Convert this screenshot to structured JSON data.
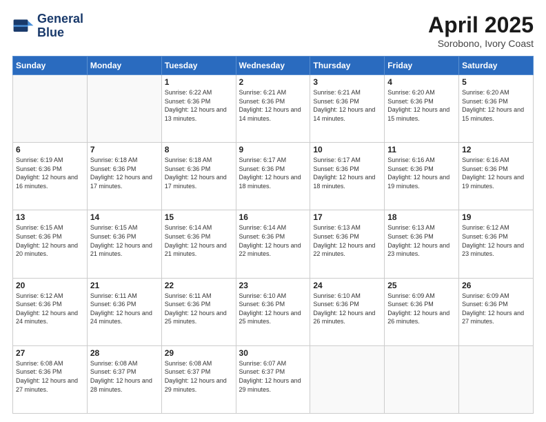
{
  "header": {
    "logo_line1": "General",
    "logo_line2": "Blue",
    "month": "April 2025",
    "location": "Sorobono, Ivory Coast"
  },
  "days_of_week": [
    "Sunday",
    "Monday",
    "Tuesday",
    "Wednesday",
    "Thursday",
    "Friday",
    "Saturday"
  ],
  "weeks": [
    [
      {
        "day": "",
        "sunrise": "",
        "sunset": "",
        "daylight": ""
      },
      {
        "day": "",
        "sunrise": "",
        "sunset": "",
        "daylight": ""
      },
      {
        "day": "1",
        "sunrise": "Sunrise: 6:22 AM",
        "sunset": "Sunset: 6:36 PM",
        "daylight": "Daylight: 12 hours and 13 minutes."
      },
      {
        "day": "2",
        "sunrise": "Sunrise: 6:21 AM",
        "sunset": "Sunset: 6:36 PM",
        "daylight": "Daylight: 12 hours and 14 minutes."
      },
      {
        "day": "3",
        "sunrise": "Sunrise: 6:21 AM",
        "sunset": "Sunset: 6:36 PM",
        "daylight": "Daylight: 12 hours and 14 minutes."
      },
      {
        "day": "4",
        "sunrise": "Sunrise: 6:20 AM",
        "sunset": "Sunset: 6:36 PM",
        "daylight": "Daylight: 12 hours and 15 minutes."
      },
      {
        "day": "5",
        "sunrise": "Sunrise: 6:20 AM",
        "sunset": "Sunset: 6:36 PM",
        "daylight": "Daylight: 12 hours and 15 minutes."
      }
    ],
    [
      {
        "day": "6",
        "sunrise": "Sunrise: 6:19 AM",
        "sunset": "Sunset: 6:36 PM",
        "daylight": "Daylight: 12 hours and 16 minutes."
      },
      {
        "day": "7",
        "sunrise": "Sunrise: 6:18 AM",
        "sunset": "Sunset: 6:36 PM",
        "daylight": "Daylight: 12 hours and 17 minutes."
      },
      {
        "day": "8",
        "sunrise": "Sunrise: 6:18 AM",
        "sunset": "Sunset: 6:36 PM",
        "daylight": "Daylight: 12 hours and 17 minutes."
      },
      {
        "day": "9",
        "sunrise": "Sunrise: 6:17 AM",
        "sunset": "Sunset: 6:36 PM",
        "daylight": "Daylight: 12 hours and 18 minutes."
      },
      {
        "day": "10",
        "sunrise": "Sunrise: 6:17 AM",
        "sunset": "Sunset: 6:36 PM",
        "daylight": "Daylight: 12 hours and 18 minutes."
      },
      {
        "day": "11",
        "sunrise": "Sunrise: 6:16 AM",
        "sunset": "Sunset: 6:36 PM",
        "daylight": "Daylight: 12 hours and 19 minutes."
      },
      {
        "day": "12",
        "sunrise": "Sunrise: 6:16 AM",
        "sunset": "Sunset: 6:36 PM",
        "daylight": "Daylight: 12 hours and 19 minutes."
      }
    ],
    [
      {
        "day": "13",
        "sunrise": "Sunrise: 6:15 AM",
        "sunset": "Sunset: 6:36 PM",
        "daylight": "Daylight: 12 hours and 20 minutes."
      },
      {
        "day": "14",
        "sunrise": "Sunrise: 6:15 AM",
        "sunset": "Sunset: 6:36 PM",
        "daylight": "Daylight: 12 hours and 21 minutes."
      },
      {
        "day": "15",
        "sunrise": "Sunrise: 6:14 AM",
        "sunset": "Sunset: 6:36 PM",
        "daylight": "Daylight: 12 hours and 21 minutes."
      },
      {
        "day": "16",
        "sunrise": "Sunrise: 6:14 AM",
        "sunset": "Sunset: 6:36 PM",
        "daylight": "Daylight: 12 hours and 22 minutes."
      },
      {
        "day": "17",
        "sunrise": "Sunrise: 6:13 AM",
        "sunset": "Sunset: 6:36 PM",
        "daylight": "Daylight: 12 hours and 22 minutes."
      },
      {
        "day": "18",
        "sunrise": "Sunrise: 6:13 AM",
        "sunset": "Sunset: 6:36 PM",
        "daylight": "Daylight: 12 hours and 23 minutes."
      },
      {
        "day": "19",
        "sunrise": "Sunrise: 6:12 AM",
        "sunset": "Sunset: 6:36 PM",
        "daylight": "Daylight: 12 hours and 23 minutes."
      }
    ],
    [
      {
        "day": "20",
        "sunrise": "Sunrise: 6:12 AM",
        "sunset": "Sunset: 6:36 PM",
        "daylight": "Daylight: 12 hours and 24 minutes."
      },
      {
        "day": "21",
        "sunrise": "Sunrise: 6:11 AM",
        "sunset": "Sunset: 6:36 PM",
        "daylight": "Daylight: 12 hours and 24 minutes."
      },
      {
        "day": "22",
        "sunrise": "Sunrise: 6:11 AM",
        "sunset": "Sunset: 6:36 PM",
        "daylight": "Daylight: 12 hours and 25 minutes."
      },
      {
        "day": "23",
        "sunrise": "Sunrise: 6:10 AM",
        "sunset": "Sunset: 6:36 PM",
        "daylight": "Daylight: 12 hours and 25 minutes."
      },
      {
        "day": "24",
        "sunrise": "Sunrise: 6:10 AM",
        "sunset": "Sunset: 6:36 PM",
        "daylight": "Daylight: 12 hours and 26 minutes."
      },
      {
        "day": "25",
        "sunrise": "Sunrise: 6:09 AM",
        "sunset": "Sunset: 6:36 PM",
        "daylight": "Daylight: 12 hours and 26 minutes."
      },
      {
        "day": "26",
        "sunrise": "Sunrise: 6:09 AM",
        "sunset": "Sunset: 6:36 PM",
        "daylight": "Daylight: 12 hours and 27 minutes."
      }
    ],
    [
      {
        "day": "27",
        "sunrise": "Sunrise: 6:08 AM",
        "sunset": "Sunset: 6:36 PM",
        "daylight": "Daylight: 12 hours and 27 minutes."
      },
      {
        "day": "28",
        "sunrise": "Sunrise: 6:08 AM",
        "sunset": "Sunset: 6:37 PM",
        "daylight": "Daylight: 12 hours and 28 minutes."
      },
      {
        "day": "29",
        "sunrise": "Sunrise: 6:08 AM",
        "sunset": "Sunset: 6:37 PM",
        "daylight": "Daylight: 12 hours and 29 minutes."
      },
      {
        "day": "30",
        "sunrise": "Sunrise: 6:07 AM",
        "sunset": "Sunset: 6:37 PM",
        "daylight": "Daylight: 12 hours and 29 minutes."
      },
      {
        "day": "",
        "sunrise": "",
        "sunset": "",
        "daylight": ""
      },
      {
        "day": "",
        "sunrise": "",
        "sunset": "",
        "daylight": ""
      },
      {
        "day": "",
        "sunrise": "",
        "sunset": "",
        "daylight": ""
      }
    ]
  ]
}
